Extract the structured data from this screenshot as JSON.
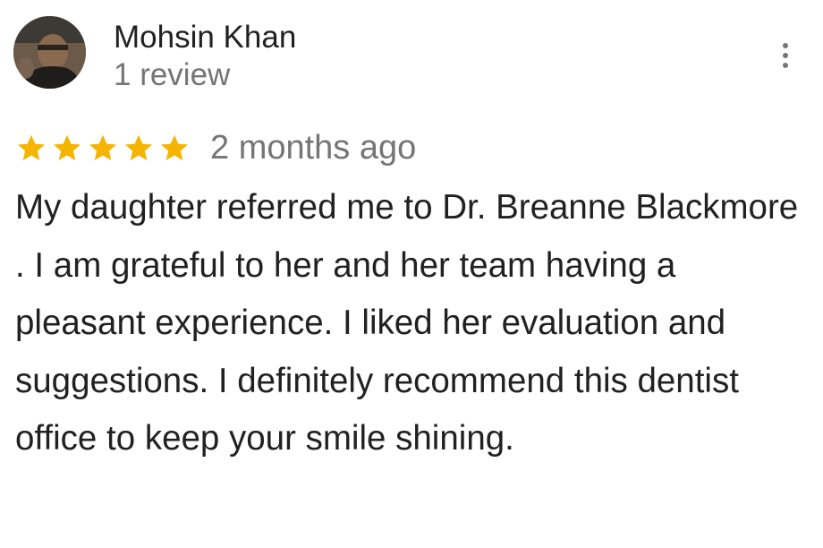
{
  "reviewer": {
    "name": "Mohsin Khan",
    "review_count": "1 review",
    "avatar_icon": "user-avatar-photo"
  },
  "menu": {
    "icon": "more-vertical-icon"
  },
  "rating": {
    "stars": 5,
    "max_stars": 5,
    "star_color": "#F4B400",
    "date": "2 months ago"
  },
  "review": {
    "text": "My daughter referred me to Dr. Breanne Blackmore . I am grateful to her and her team having a pleasant experience. I liked her evaluation and suggestions. I definitely recommend this dentist office to keep your smile shining."
  }
}
